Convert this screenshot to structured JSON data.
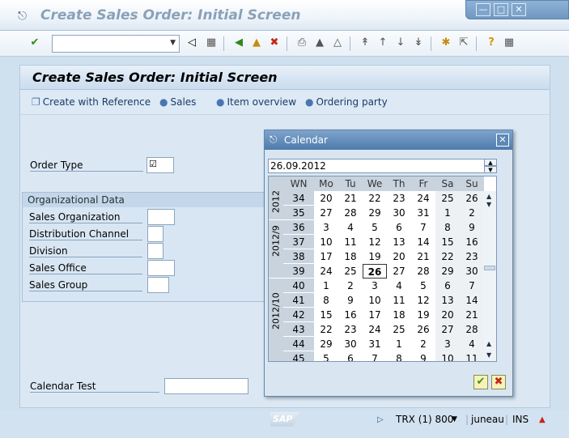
{
  "window": {
    "title": "Create Sales Order: Initial Screen",
    "controls": [
      "minimize",
      "maximize",
      "close"
    ]
  },
  "toolbar": {
    "command_field": "",
    "icons": [
      "enter-icon",
      "back-arrow-icon",
      "save-icon",
      "back-icon",
      "exit-icon",
      "cancel-icon",
      "print-icon",
      "find-icon",
      "find-next-icon",
      "first-page-icon",
      "previous-page-icon",
      "next-page-icon",
      "last-page-icon",
      "create-session-icon",
      "shortcut-icon",
      "help-icon",
      "customize-layout-icon"
    ]
  },
  "screen": {
    "title": "Create Sales Order: Initial Screen",
    "app_toolbar": [
      "Create with Reference",
      "Sales",
      "Item overview",
      "Ordering party"
    ],
    "order_type_label": "Order Type",
    "org_group_title": "Organizational Data",
    "fields": [
      {
        "label": "Sales Organization",
        "value": ""
      },
      {
        "label": "Distribution Channel",
        "value": ""
      },
      {
        "label": "Division",
        "value": ""
      },
      {
        "label": "Sales Office",
        "value": ""
      },
      {
        "label": "Sales Group",
        "value": ""
      }
    ],
    "calendar_test_label": "Calendar Test",
    "calendar_test_value": ""
  },
  "calendar": {
    "title": "Calendar",
    "date_value": "26.09.2012",
    "header": [
      "WN",
      "Mo",
      "Tu",
      "We",
      "Th",
      "Fr",
      "Sa",
      "Su"
    ],
    "month_labels": [
      "2012",
      "2012/9",
      "2012/10"
    ],
    "weeks": [
      {
        "wn": "34",
        "days": [
          "20",
          "21",
          "22",
          "23",
          "24",
          "25",
          "26"
        ]
      },
      {
        "wn": "35",
        "days": [
          "27",
          "28",
          "29",
          "30",
          "31",
          "1",
          "2"
        ]
      },
      {
        "wn": "36",
        "days": [
          "3",
          "4",
          "5",
          "6",
          "7",
          "8",
          "9"
        ]
      },
      {
        "wn": "37",
        "days": [
          "10",
          "11",
          "12",
          "13",
          "14",
          "15",
          "16"
        ]
      },
      {
        "wn": "38",
        "days": [
          "17",
          "18",
          "19",
          "20",
          "21",
          "22",
          "23"
        ]
      },
      {
        "wn": "39",
        "days": [
          "24",
          "25",
          "26",
          "27",
          "28",
          "29",
          "30"
        ]
      },
      {
        "wn": "40",
        "days": [
          "1",
          "2",
          "3",
          "4",
          "5",
          "6",
          "7"
        ]
      },
      {
        "wn": "41",
        "days": [
          "8",
          "9",
          "10",
          "11",
          "12",
          "13",
          "14"
        ]
      },
      {
        "wn": "42",
        "days": [
          "15",
          "16",
          "17",
          "18",
          "19",
          "20",
          "21"
        ]
      },
      {
        "wn": "43",
        "days": [
          "22",
          "23",
          "24",
          "25",
          "26",
          "27",
          "28"
        ]
      },
      {
        "wn": "44",
        "days": [
          "29",
          "30",
          "31",
          "1",
          "2",
          "3",
          "4"
        ]
      },
      {
        "wn": "45",
        "days": [
          "5",
          "6",
          "7",
          "8",
          "9",
          "10",
          "11"
        ]
      }
    ],
    "selected_day": "26",
    "ok_icon": "checkmark-icon",
    "cancel_icon": "cancel-x-icon"
  },
  "statusbar": {
    "system": "TRX (1) 800",
    "server": "juneau",
    "mode": "INS",
    "logo": "SAP"
  },
  "colors": {
    "background": "#cfe0ef",
    "title_bar": "#4e7bab",
    "weekend": "#eef1f4"
  }
}
